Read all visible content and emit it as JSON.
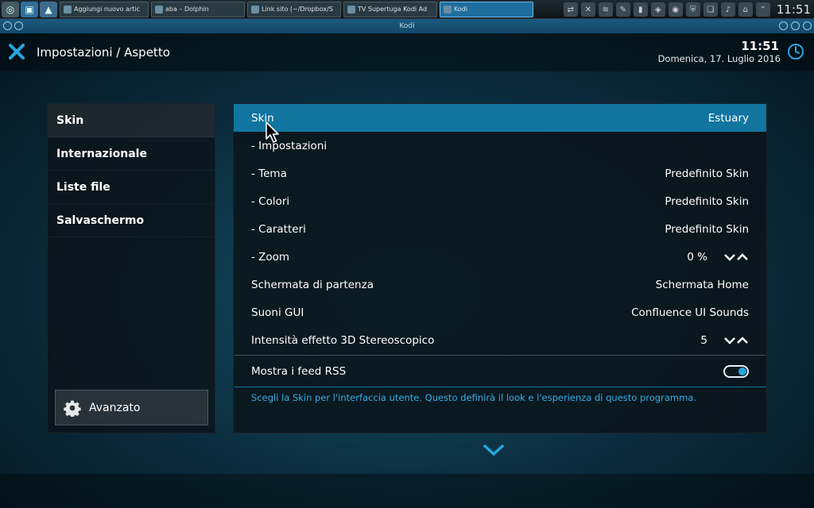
{
  "taskbar": {
    "tasks": [
      {
        "label": "Aggiungi nuovo artic"
      },
      {
        "label": "aba – Dolphin"
      },
      {
        "label": "Link sito (~/Dropbox/S"
      },
      {
        "label": "TV Supertuga Kodi Ad"
      },
      {
        "label": "Kodi"
      }
    ],
    "clock": "11:51"
  },
  "window": {
    "title": "Kodi"
  },
  "header": {
    "title": "Impostazioni / Aspetto",
    "time": "11:51",
    "date": "Domenica, 17. Luglio 2016"
  },
  "sidebar": {
    "items": [
      {
        "label": "Skin"
      },
      {
        "label": "Internazionale"
      },
      {
        "label": "Liste file"
      },
      {
        "label": "Salvaschermo"
      }
    ],
    "advanced_label": "Avanzato"
  },
  "settings": {
    "rows": [
      {
        "label": "Skin",
        "value": "Estuary"
      },
      {
        "label": "- Impostazioni",
        "value": ""
      },
      {
        "label": "- Tema",
        "value": "Predefinito Skin"
      },
      {
        "label": "- Colori",
        "value": "Predefinito Skin"
      },
      {
        "label": "- Caratteri",
        "value": "Predefinito Skin"
      },
      {
        "label": "- Zoom",
        "value": "0 %"
      },
      {
        "label": "Schermata di partenza",
        "value": "Schermata Home"
      },
      {
        "label": "Suoni GUI",
        "value": "Confluence UI Sounds"
      },
      {
        "label": "Intensità effetto 3D Stereoscopico",
        "value": "5"
      }
    ],
    "rss": {
      "label": "Mostra i feed RSS",
      "enabled": true
    },
    "description": "Scegli la Skin per l'interfaccia utente. Questo definirà il look e l'esperienza di questo programma."
  },
  "colors": {
    "accent": "#12759f",
    "description_text": "#37aee6"
  }
}
